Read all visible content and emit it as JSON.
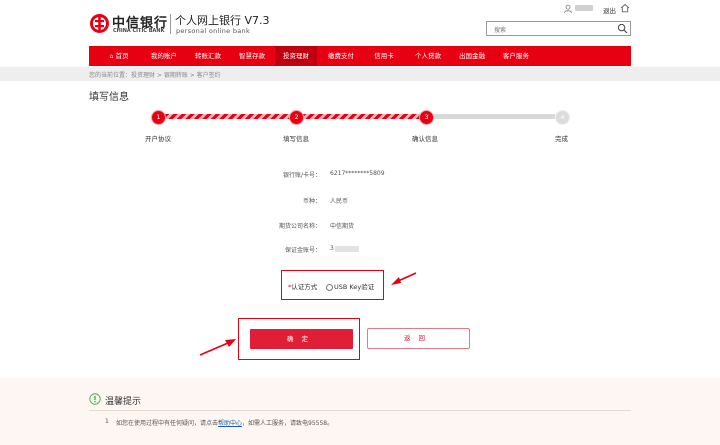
{
  "header": {
    "bank_name_cn": "中信银行",
    "bank_name_en": "CHINA CITIC BANK",
    "product_title": "个人网上银行 V7.3",
    "product_subtitle": "personal online bank",
    "logout": "退出",
    "search_placeholder": "搜索"
  },
  "nav": {
    "items": [
      {
        "label": "首页",
        "icon": "home-icon"
      },
      {
        "label": "我的账户"
      },
      {
        "label": "转账汇款"
      },
      {
        "label": "智慧存款"
      },
      {
        "label": "投资理财"
      },
      {
        "label": "缴费支付"
      },
      {
        "label": "信用卡"
      },
      {
        "label": "个人贷款"
      },
      {
        "label": "出国金融"
      },
      {
        "label": "客户服务"
      }
    ],
    "active": "投资理财"
  },
  "breadcrumb": "您的当前位置：投资理财 > 银期转账 > 客户签约",
  "page_title": "填写信息",
  "steps": [
    {
      "num": "1",
      "label": "开户协议"
    },
    {
      "num": "2",
      "label": "填写信息"
    },
    {
      "num": "3",
      "label": "确认信息"
    },
    {
      "num": "4",
      "label": "完成"
    }
  ],
  "form": {
    "account_label": "银行账/卡号：",
    "account_value": "6217********5809",
    "currency_label": "币种：",
    "currency_value": "人民币",
    "company_label": "期货公司名称：",
    "company_value": "中信期货",
    "margin_label": "保证金账号：",
    "margin_value": "3",
    "auth_required_mark": "*",
    "auth_label": "认证方式",
    "auth_option": "USB Key验证"
  },
  "buttons": {
    "confirm": "确定",
    "back": "返回"
  },
  "tips": {
    "title": "温馨提示",
    "num": "1",
    "text_before": "如您在使用过程中有任何疑问，请点击",
    "link": "帮助中心",
    "text_after": "，如需人工服务，请致电95558。"
  },
  "colors": {
    "brand_red": "#e60012",
    "nav_active": "#c0000e",
    "button_red": "#e01e35",
    "link_blue": "#1a5fb4"
  }
}
